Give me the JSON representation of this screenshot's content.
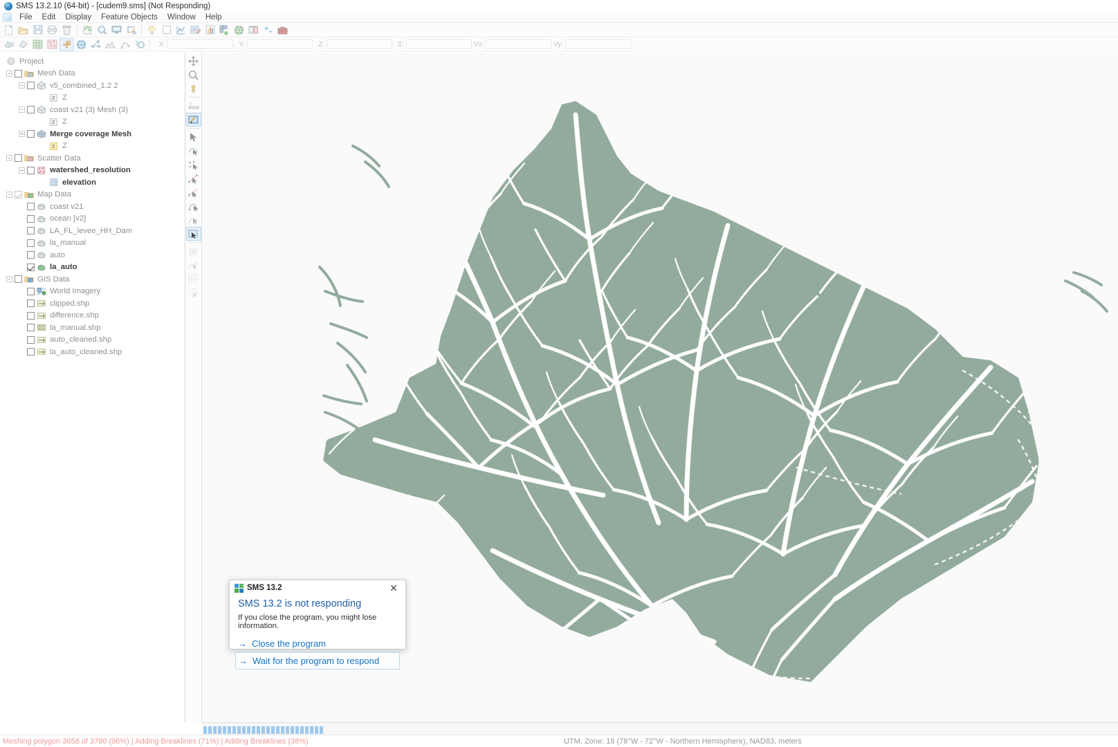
{
  "window": {
    "title": "SMS 13.2.10 (64-bit) - [cudem9.sms] (Not Responding)",
    "app_icon": "sms-app-icon"
  },
  "menubar": {
    "doc_icon": "document-icon",
    "items": [
      "File",
      "Edit",
      "Display",
      "Feature Objects",
      "Window",
      "Help"
    ]
  },
  "toolbar_row1": {
    "buttons": [
      {
        "name": "new-file-icon",
        "title": "New"
      },
      {
        "name": "open-folder-icon",
        "title": "Open"
      },
      {
        "name": "save-icon",
        "title": "Save"
      },
      {
        "name": "print-icon",
        "title": "Print"
      },
      {
        "name": "delete-trash-icon",
        "title": "Delete"
      },
      {
        "name": "refresh-frame-icon",
        "title": "Frame Image"
      },
      {
        "name": "zoom-icon",
        "title": "Zoom"
      },
      {
        "name": "display-monitor-icon",
        "title": "Display Options"
      },
      {
        "name": "rotate-view-icon",
        "title": "Rotate"
      },
      {
        "name": "lightbulb-icon",
        "title": "Lighting"
      },
      {
        "name": "blank-square-icon",
        "title": "View"
      },
      {
        "name": "plot-axes-icon",
        "title": "Plot"
      },
      {
        "name": "edit-properties-icon",
        "title": "Properties"
      },
      {
        "name": "bar-chart-icon",
        "title": "Chart"
      },
      {
        "name": "add-grid-icon",
        "title": "Add Grid"
      },
      {
        "name": "globe-icon",
        "title": "Projection"
      },
      {
        "name": "extrude-icon",
        "title": "Extrude"
      },
      {
        "name": "sparkle-icon",
        "title": "Smooth"
      },
      {
        "name": "toolbox-icon",
        "title": "Toolbox"
      }
    ]
  },
  "toolbar_row2": {
    "buttons": [
      {
        "name": "mesh-module-icon",
        "title": "Mesh Module"
      },
      {
        "name": "quadtree-module-icon",
        "title": "Quadtree Module"
      },
      {
        "name": "grid-module-icon",
        "title": "Grid Module"
      },
      {
        "name": "scatter-module-icon",
        "title": "Scatter Module"
      },
      {
        "name": "map-module-icon",
        "title": "Map Module"
      },
      {
        "name": "gis-module-icon",
        "title": "GIS Module"
      },
      {
        "name": "particle-module-icon",
        "title": "Particle Module"
      },
      {
        "name": "profile-module-icon",
        "title": "Profile Module"
      },
      {
        "name": "curve-module-icon",
        "title": "Curve Module"
      },
      {
        "name": "annotation-module-icon",
        "title": "Annotation Module"
      }
    ],
    "coords": [
      {
        "label": "X:",
        "value": "",
        "name": "x-coordinate-input"
      },
      {
        "label": "Y:",
        "value": "",
        "name": "y-coordinate-input"
      },
      {
        "label": "Z:",
        "value": "",
        "name": "z-coordinate-input"
      },
      {
        "label": "S:",
        "value": "",
        "name": "s-value-input"
      },
      {
        "label": "Vx:",
        "value": "",
        "name": "vx-value-input"
      },
      {
        "label": "Vy:",
        "value": "",
        "name": "vy-value-input"
      }
    ]
  },
  "tree": {
    "root_label": "Project",
    "root_icon": "project-sphere-icon",
    "items": [
      {
        "label": "Mesh Data",
        "icon": "mesh-folder-icon",
        "depth": 0,
        "checkbox": "unchecked",
        "expander": "minus",
        "bold": false
      },
      {
        "label": "v5_combined_1.2 2",
        "icon": "mesh-icon",
        "depth": 1,
        "checkbox": "unchecked",
        "expander": "minus",
        "bold": false
      },
      {
        "label": "Z",
        "icon": "z-dataset-icon",
        "depth": 2,
        "checkbox": "none",
        "expander": "none",
        "bold": false
      },
      {
        "label": "coast v21 (3) Mesh (3)",
        "icon": "mesh-icon",
        "depth": 1,
        "checkbox": "unchecked",
        "expander": "minus",
        "bold": false
      },
      {
        "label": "Z",
        "icon": "z-dataset-icon",
        "depth": 2,
        "checkbox": "none",
        "expander": "none",
        "bold": false
      },
      {
        "label": "Merge coverage Mesh",
        "icon": "mesh-icon-active",
        "depth": 1,
        "checkbox": "unchecked",
        "expander": "minus",
        "bold": true
      },
      {
        "label": "Z",
        "icon": "z-dataset-icon-active",
        "depth": 2,
        "checkbox": "none",
        "expander": "none",
        "bold": false
      },
      {
        "label": "Scatter Data",
        "icon": "scatter-folder-icon",
        "depth": 0,
        "checkbox": "unchecked",
        "expander": "minus",
        "bold": false
      },
      {
        "label": "watershed_resolution",
        "icon": "scatter-set-icon",
        "depth": 1,
        "checkbox": "unchecked",
        "expander": "minus",
        "bold": true
      },
      {
        "label": "elevation",
        "icon": "dataset-table-icon",
        "depth": 2,
        "checkbox": "none",
        "expander": "none",
        "bold": true
      },
      {
        "label": "Map Data",
        "icon": "map-folder-icon",
        "depth": 0,
        "checkbox": "checked-gray",
        "expander": "minus",
        "bold": false
      },
      {
        "label": "coast v21",
        "icon": "coverage-icon",
        "depth": 1,
        "checkbox": "unchecked",
        "expander": "none",
        "bold": false
      },
      {
        "label": "ocean [v2]",
        "icon": "coverage-icon",
        "depth": 1,
        "checkbox": "unchecked",
        "expander": "none",
        "bold": false
      },
      {
        "label": "LA_FL_levee_HH_Dam",
        "icon": "coverage-icon",
        "depth": 1,
        "checkbox": "unchecked",
        "expander": "none",
        "bold": false
      },
      {
        "label": "la_manual",
        "icon": "coverage-icon",
        "depth": 1,
        "checkbox": "unchecked",
        "expander": "none",
        "bold": false
      },
      {
        "label": "auto",
        "icon": "coverage-icon",
        "depth": 1,
        "checkbox": "unchecked",
        "expander": "none",
        "bold": false
      },
      {
        "label": "la_auto",
        "icon": "coverage-icon-active",
        "depth": 1,
        "checkbox": "checked",
        "expander": "none",
        "bold": true
      },
      {
        "label": "GIS Data",
        "icon": "gis-folder-icon",
        "depth": 0,
        "checkbox": "unchecked",
        "expander": "minus",
        "bold": false
      },
      {
        "label": "World Imagery",
        "icon": "world-imagery-icon",
        "depth": 1,
        "checkbox": "unchecked",
        "expander": "none",
        "bold": false
      },
      {
        "label": "clipped.shp",
        "icon": "shapefile-icon",
        "depth": 1,
        "checkbox": "unchecked",
        "expander": "none",
        "bold": false
      },
      {
        "label": "difference.shp",
        "icon": "shapefile-icon",
        "depth": 1,
        "checkbox": "unchecked",
        "expander": "none",
        "bold": false
      },
      {
        "label": "la_manual.shp",
        "icon": "shapefile-raster-icon",
        "depth": 1,
        "checkbox": "unchecked",
        "expander": "none",
        "bold": false
      },
      {
        "label": "auto_cleaned.shp",
        "icon": "shapefile-icon",
        "depth": 1,
        "checkbox": "unchecked",
        "expander": "none",
        "bold": false
      },
      {
        "label": "la_auto_cleaned.shp",
        "icon": "shapefile-icon",
        "depth": 1,
        "checkbox": "unchecked",
        "expander": "none",
        "bold": false
      }
    ]
  },
  "vtools": {
    "buttons": [
      {
        "name": "pan-move-icon",
        "selected": false
      },
      {
        "name": "zoom-magnifier-icon",
        "selected": false
      },
      {
        "name": "rotate-icon",
        "selected": false
      },
      {
        "name": "measure-icon",
        "selected": false
      },
      {
        "name": "select-display-icon",
        "selected": true
      },
      {
        "name": "arrow-select-icon",
        "selected": false
      },
      {
        "name": "select-feature-arc-icon",
        "selected": false
      },
      {
        "name": "select-feature-point-icon",
        "selected": false
      },
      {
        "name": "create-feature-vertex-icon",
        "selected": false
      },
      {
        "name": "create-feature-arc-icon",
        "selected": false
      },
      {
        "name": "select-arc-group-icon",
        "selected": false
      },
      {
        "name": "select-polygon-icon",
        "selected": true
      },
      {
        "name": "select-arc-chain-icon",
        "selected": false
      },
      {
        "name": "split-arc-icon",
        "selected": false
      },
      {
        "name": "select-cell-icon",
        "selected": false
      },
      {
        "name": "select-grid-icon",
        "selected": false
      },
      {
        "name": "select-circle-icon",
        "selected": false
      }
    ]
  },
  "map": {
    "land_color": "#93ab9d",
    "stream_color": "#ffffff",
    "background_color": "#fafafa",
    "outline_color": "#93ab9d",
    "coverage_name": "la_auto"
  },
  "dialog": {
    "icon": "sms-window-icon",
    "title": "SMS 13.2",
    "close_label": "✕",
    "heading": "SMS 13.2 is not responding",
    "body": "If you close the program, you might lose information.",
    "options": [
      {
        "arrow": "→",
        "label": "Close the program",
        "name": "close-the-program-option",
        "boxed": false
      },
      {
        "arrow": "→",
        "label": "Wait for the program to respond",
        "name": "wait-for-program-option",
        "boxed": true
      }
    ]
  },
  "status": {
    "left": "Meshing polygon 3658 of 3780 (96%) | Adding Breaklines (71%) | Adding Breaklines (38%)",
    "right": "UTM, Zone: 18 (78°W - 72°W - Northern Hemisphere), NAD83, meters",
    "progress_blocks": 25,
    "progress_color": "#9dc9ee"
  }
}
